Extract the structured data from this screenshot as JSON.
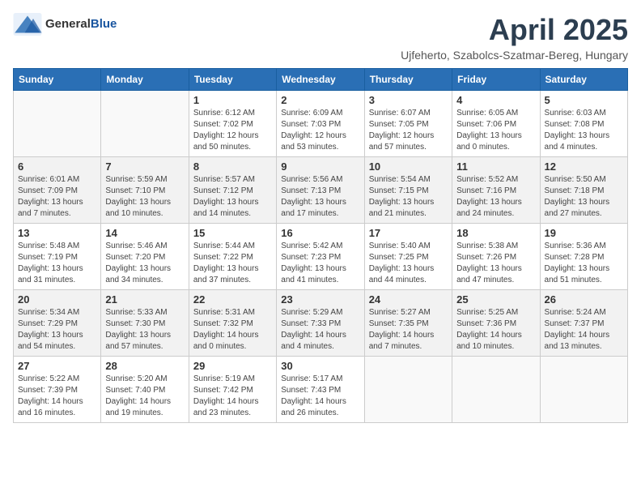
{
  "header": {
    "logo_general": "General",
    "logo_blue": "Blue",
    "month_title": "April 2025",
    "location": "Ujfeherto, Szabolcs-Szatmar-Bereg, Hungary"
  },
  "weekdays": [
    "Sunday",
    "Monday",
    "Tuesday",
    "Wednesday",
    "Thursday",
    "Friday",
    "Saturday"
  ],
  "weeks": [
    [
      {
        "day": "",
        "info": ""
      },
      {
        "day": "",
        "info": ""
      },
      {
        "day": "1",
        "info": "Sunrise: 6:12 AM\nSunset: 7:02 PM\nDaylight: 12 hours and 50 minutes."
      },
      {
        "day": "2",
        "info": "Sunrise: 6:09 AM\nSunset: 7:03 PM\nDaylight: 12 hours and 53 minutes."
      },
      {
        "day": "3",
        "info": "Sunrise: 6:07 AM\nSunset: 7:05 PM\nDaylight: 12 hours and 57 minutes."
      },
      {
        "day": "4",
        "info": "Sunrise: 6:05 AM\nSunset: 7:06 PM\nDaylight: 13 hours and 0 minutes."
      },
      {
        "day": "5",
        "info": "Sunrise: 6:03 AM\nSunset: 7:08 PM\nDaylight: 13 hours and 4 minutes."
      }
    ],
    [
      {
        "day": "6",
        "info": "Sunrise: 6:01 AM\nSunset: 7:09 PM\nDaylight: 13 hours and 7 minutes."
      },
      {
        "day": "7",
        "info": "Sunrise: 5:59 AM\nSunset: 7:10 PM\nDaylight: 13 hours and 10 minutes."
      },
      {
        "day": "8",
        "info": "Sunrise: 5:57 AM\nSunset: 7:12 PM\nDaylight: 13 hours and 14 minutes."
      },
      {
        "day": "9",
        "info": "Sunrise: 5:56 AM\nSunset: 7:13 PM\nDaylight: 13 hours and 17 minutes."
      },
      {
        "day": "10",
        "info": "Sunrise: 5:54 AM\nSunset: 7:15 PM\nDaylight: 13 hours and 21 minutes."
      },
      {
        "day": "11",
        "info": "Sunrise: 5:52 AM\nSunset: 7:16 PM\nDaylight: 13 hours and 24 minutes."
      },
      {
        "day": "12",
        "info": "Sunrise: 5:50 AM\nSunset: 7:18 PM\nDaylight: 13 hours and 27 minutes."
      }
    ],
    [
      {
        "day": "13",
        "info": "Sunrise: 5:48 AM\nSunset: 7:19 PM\nDaylight: 13 hours and 31 minutes."
      },
      {
        "day": "14",
        "info": "Sunrise: 5:46 AM\nSunset: 7:20 PM\nDaylight: 13 hours and 34 minutes."
      },
      {
        "day": "15",
        "info": "Sunrise: 5:44 AM\nSunset: 7:22 PM\nDaylight: 13 hours and 37 minutes."
      },
      {
        "day": "16",
        "info": "Sunrise: 5:42 AM\nSunset: 7:23 PM\nDaylight: 13 hours and 41 minutes."
      },
      {
        "day": "17",
        "info": "Sunrise: 5:40 AM\nSunset: 7:25 PM\nDaylight: 13 hours and 44 minutes."
      },
      {
        "day": "18",
        "info": "Sunrise: 5:38 AM\nSunset: 7:26 PM\nDaylight: 13 hours and 47 minutes."
      },
      {
        "day": "19",
        "info": "Sunrise: 5:36 AM\nSunset: 7:28 PM\nDaylight: 13 hours and 51 minutes."
      }
    ],
    [
      {
        "day": "20",
        "info": "Sunrise: 5:34 AM\nSunset: 7:29 PM\nDaylight: 13 hours and 54 minutes."
      },
      {
        "day": "21",
        "info": "Sunrise: 5:33 AM\nSunset: 7:30 PM\nDaylight: 13 hours and 57 minutes."
      },
      {
        "day": "22",
        "info": "Sunrise: 5:31 AM\nSunset: 7:32 PM\nDaylight: 14 hours and 0 minutes."
      },
      {
        "day": "23",
        "info": "Sunrise: 5:29 AM\nSunset: 7:33 PM\nDaylight: 14 hours and 4 minutes."
      },
      {
        "day": "24",
        "info": "Sunrise: 5:27 AM\nSunset: 7:35 PM\nDaylight: 14 hours and 7 minutes."
      },
      {
        "day": "25",
        "info": "Sunrise: 5:25 AM\nSunset: 7:36 PM\nDaylight: 14 hours and 10 minutes."
      },
      {
        "day": "26",
        "info": "Sunrise: 5:24 AM\nSunset: 7:37 PM\nDaylight: 14 hours and 13 minutes."
      }
    ],
    [
      {
        "day": "27",
        "info": "Sunrise: 5:22 AM\nSunset: 7:39 PM\nDaylight: 14 hours and 16 minutes."
      },
      {
        "day": "28",
        "info": "Sunrise: 5:20 AM\nSunset: 7:40 PM\nDaylight: 14 hours and 19 minutes."
      },
      {
        "day": "29",
        "info": "Sunrise: 5:19 AM\nSunset: 7:42 PM\nDaylight: 14 hours and 23 minutes."
      },
      {
        "day": "30",
        "info": "Sunrise: 5:17 AM\nSunset: 7:43 PM\nDaylight: 14 hours and 26 minutes."
      },
      {
        "day": "",
        "info": ""
      },
      {
        "day": "",
        "info": ""
      },
      {
        "day": "",
        "info": ""
      }
    ]
  ]
}
